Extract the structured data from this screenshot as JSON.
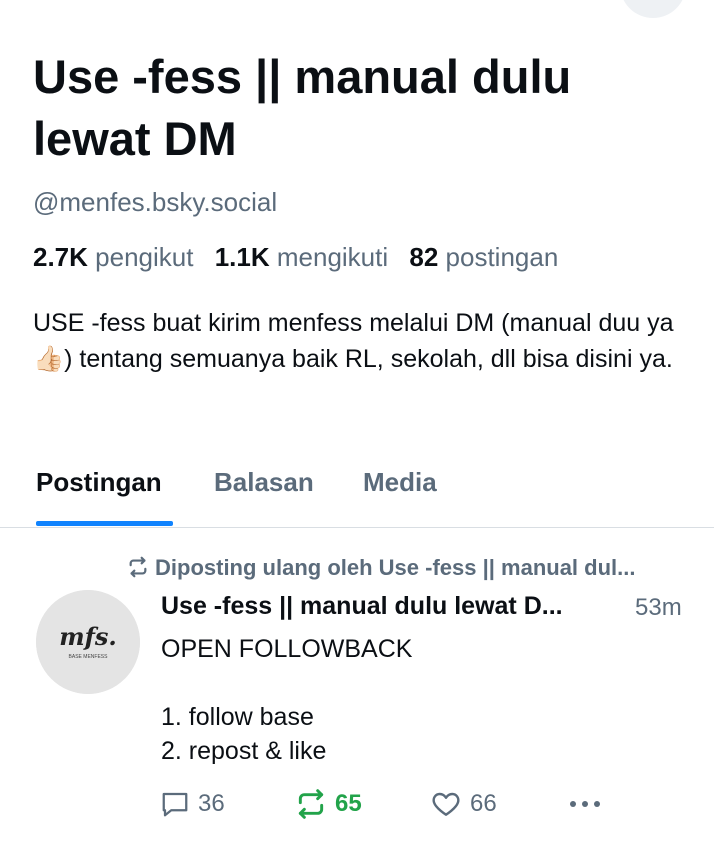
{
  "profile": {
    "name": "Use -fess || manual dulu lewat DM",
    "handle": "@menfes.bsky.social",
    "stats": {
      "followers_count": "2.7K",
      "followers_label": "pengikut",
      "following_count": "1.1K",
      "following_label": "mengikuti",
      "posts_count": "82",
      "posts_label": "postingan"
    },
    "bio": "USE -fess buat kirim menfess melalui DM (manual duu ya👍🏻) tentang semuanya baik RL, sekolah, dll bisa disini ya."
  },
  "tabs": [
    {
      "label": "Postingan",
      "active": true
    },
    {
      "label": "Balasan",
      "active": false
    },
    {
      "label": "Media",
      "active": false
    }
  ],
  "post": {
    "repost_label": "Diposting ulang oleh Use -fess || manual dul...",
    "author": "Use -fess || manual dulu lewat D...",
    "time": "53m",
    "avatar_text": "mfs.",
    "avatar_subtext": "BASE MENFESS",
    "text": "OPEN FOLLOWBACK\n\n1. follow base\n2. repost & like",
    "reply_count": "36",
    "repost_count": "65",
    "like_count": "66"
  },
  "colors": {
    "accent": "#1083fe",
    "repost_active": "#22a34a",
    "muted": "#5b6b7b"
  },
  "icons": [
    "reply-icon",
    "repost-icon",
    "like-icon",
    "more-icon"
  ]
}
